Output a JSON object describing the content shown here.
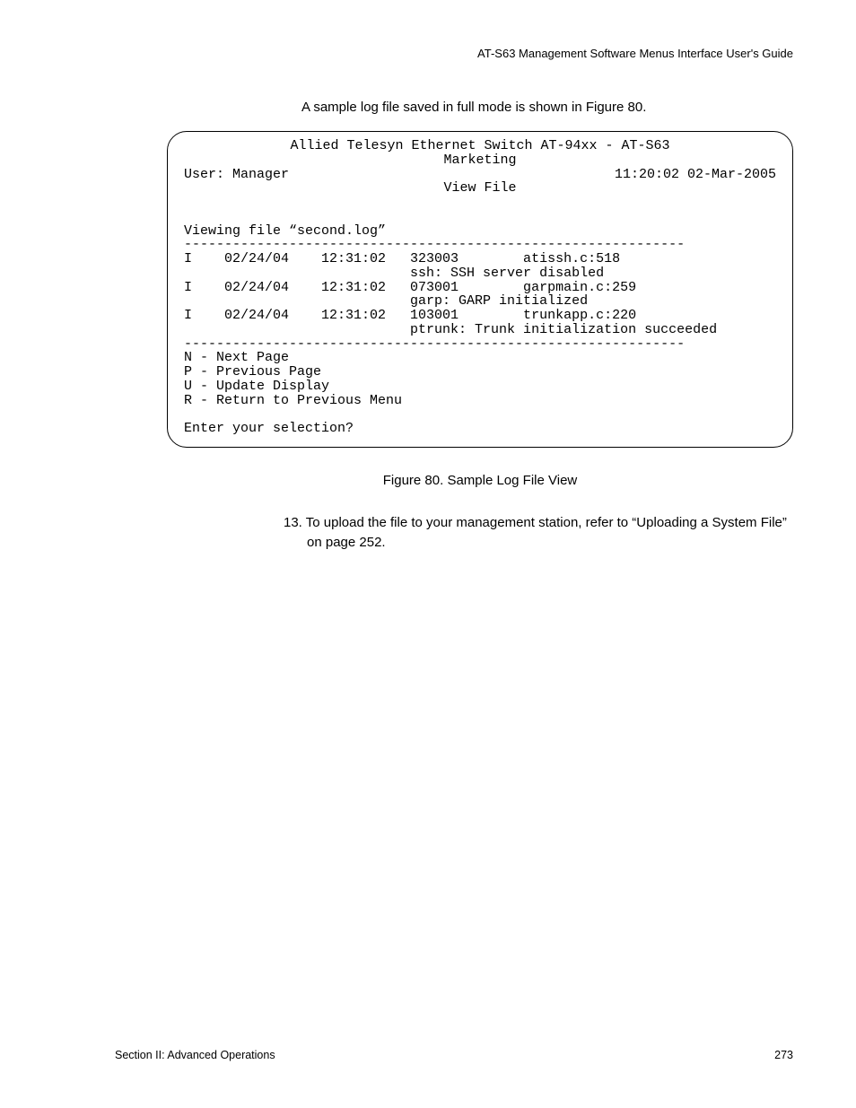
{
  "header": {
    "guide_title": "AT-S63 Management Software Menus Interface User's Guide"
  },
  "intro": "A sample log file saved in full mode is shown in Figure 80.",
  "terminal": {
    "title_line1": "Allied Telesyn Ethernet Switch AT-94xx - AT-S63",
    "title_line2": "Marketing",
    "user_label": "User: Manager",
    "datetime": "11:20:02 02-Mar-2005",
    "subtitle": "View File",
    "viewing": "Viewing file “second.log”",
    "divider": "--------------------------------------------------------------",
    "log_entries": [
      {
        "lvl": "I",
        "date": "02/24/04",
        "time": "12:31:02",
        "id": "323003",
        "src": "atissh.c:518",
        "msg": "ssh: SSH server disabled"
      },
      {
        "lvl": "I",
        "date": "02/24/04",
        "time": "12:31:02",
        "id": "073001",
        "src": "garpmain.c:259",
        "msg": "garp: GARP initialized"
      },
      {
        "lvl": "I",
        "date": "02/24/04",
        "time": "12:31:02",
        "id": "103001",
        "src": "trunkapp.c:220",
        "msg": "ptrunk: Trunk initialization succeeded"
      }
    ],
    "menu": [
      "N - Next Page",
      "P - Previous Page",
      "U - Update Display",
      "R - Return to Previous Menu"
    ],
    "prompt": "Enter your selection?"
  },
  "caption": "Figure 80. Sample Log File View",
  "step": {
    "num": "13.",
    "text": "To upload the file to your management station, refer to “Uploading a System File” on page 252."
  },
  "footer": {
    "left": "Section II: Advanced Operations",
    "right": "273"
  }
}
